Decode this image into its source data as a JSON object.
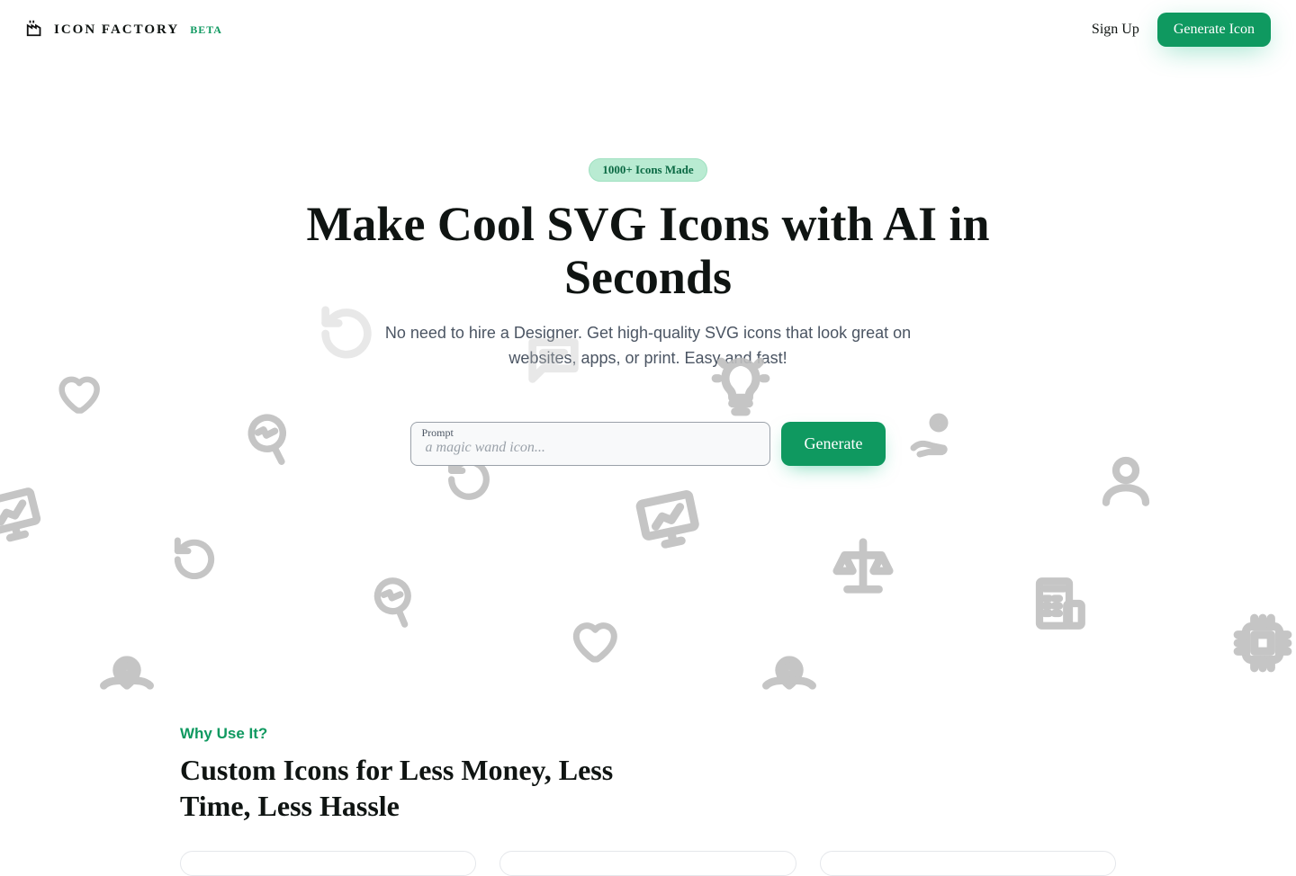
{
  "header": {
    "brand_name": "ICON FACTORY",
    "brand_badge": "BETA",
    "signup_label": "Sign Up",
    "cta_label": "Generate Icon"
  },
  "hero": {
    "badge": "1000+ Icons Made",
    "headline": "Make Cool SVG Icons with AI in Seconds",
    "subhead": "No need to hire a Designer. Get high-quality SVG icons that look great on websites, apps, or print. Easy and fast!",
    "prompt_label": "Prompt",
    "prompt_placeholder": "a magic wand icon...",
    "generate_label": "Generate"
  },
  "bg_icons": [
    "heart-icon",
    "refresh-icon",
    "magnifier-chart-icon",
    "presentation-icon",
    "lightbulb-icon",
    "user-icon",
    "hand-coin-icon",
    "scales-icon",
    "calculator-icon",
    "map-pin-icon",
    "processor-icon",
    "heart-icon",
    "magnifier-chart-icon",
    "refresh-icon",
    "map-pin-icon",
    "speech-icon"
  ],
  "why": {
    "eyebrow": "Why Use It?",
    "headline": "Custom Icons for Less Money, Less Time, Less Hassle"
  }
}
